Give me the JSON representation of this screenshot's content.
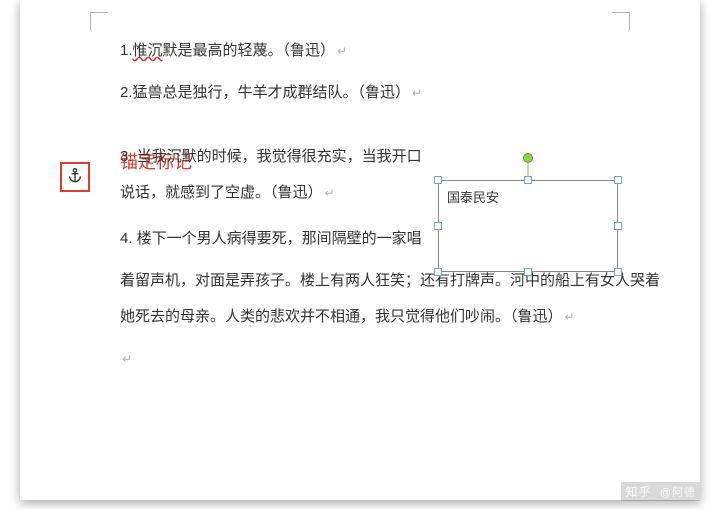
{
  "anchor_label": "锚定标记",
  "paragraphs": {
    "p1": "1.惟沉默是最高的轻蔑。（鲁迅）",
    "p2": "2.猛兽总是独行，牛羊才成群结队。（鲁迅）",
    "p3": "3. 当我沉默的时候，我觉得很充实，当我开口说话，就感到了空虚。（鲁迅）",
    "p4a": "4. 楼下一个男人病得要死，那间隔壁的一家唱",
    "p4b": "着留声机，对面是弄孩子。楼上有两人狂笑；还有打牌声。河中的船上有女人哭着她死去的母亲。人类的悲欢并不相通，我只觉得他们吵闹。（鲁迅）"
  },
  "textbox_text": "国泰民安",
  "return_mark": "↵",
  "watermark": {
    "site": "知乎",
    "author": "@阿德"
  },
  "squiggle_segment": "惟沉",
  "p1_after_squiggle": "默是最高的轻蔑。（鲁迅）",
  "p1_prefix": "1."
}
